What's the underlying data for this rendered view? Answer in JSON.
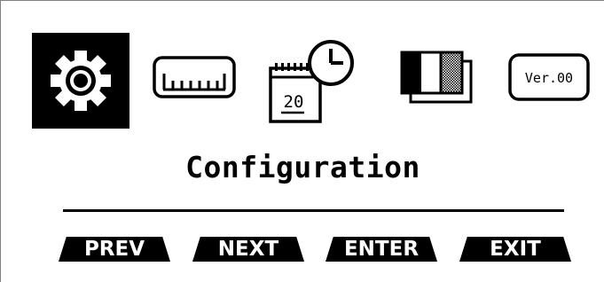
{
  "menu": {
    "items": [
      {
        "id": "configuration",
        "icon": "gear-icon",
        "selected": true
      },
      {
        "id": "measurement",
        "icon": "ruler-icon",
        "selected": false
      },
      {
        "id": "date-time",
        "icon": "calendar-clock-icon",
        "selected": false,
        "day_text": "20"
      },
      {
        "id": "contrast",
        "icon": "contrast-icon",
        "selected": false
      },
      {
        "id": "version",
        "icon": "version-icon",
        "selected": false,
        "label": "Ver.00"
      }
    ],
    "selected_title": "Configuration"
  },
  "softkeys": {
    "prev": "PREV",
    "next": "NEXT",
    "enter": "ENTER",
    "exit": "EXIT"
  },
  "colors": {
    "foreground": "#000000",
    "background": "#ffffff",
    "selected_bg": "#000000",
    "selected_fg": "#ffffff"
  }
}
